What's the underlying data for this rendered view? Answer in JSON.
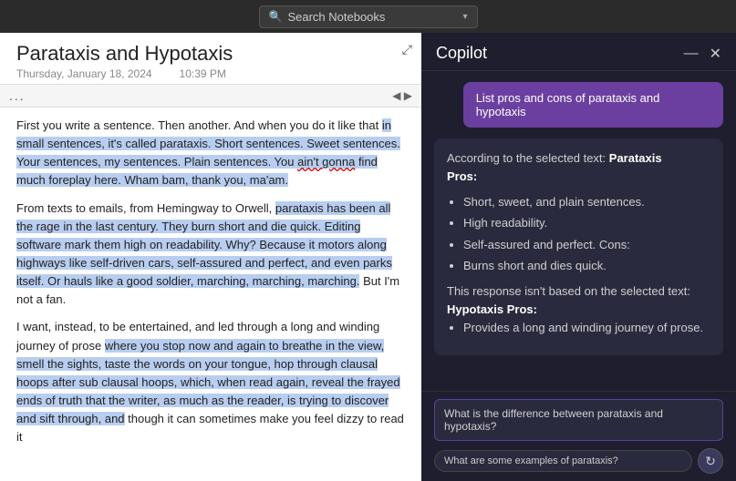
{
  "topbar": {
    "search_placeholder": "Search Notebooks",
    "search_icon": "🔍",
    "chevron_icon": "▾"
  },
  "note": {
    "title": "Parataxis and Hypotaxis",
    "date": "Thursday, January 18, 2024",
    "time": "10:39 PM",
    "expand_icon": "⤢",
    "toolbar_dots": "...",
    "scroll_arrow": "◀ ▶",
    "paragraphs": [
      {
        "id": "p1",
        "text": "First you write a sentence. Then another. And when you do it like that in small sentences, it's called parataxis. Short sentences. Sweet sentences. Your sentences, my sentences. Plain sentences. You ain't gonna find much foreplay here. Wham bam, thank you, ma'am."
      },
      {
        "id": "p2",
        "text": "From texts to emails, from Hemingway to Orwell, parataxis has been all the rage in the last century. They burn short and die quick. Editing software mark them high on readability. Why? Because it motors along highways like self-driven cars, self-assured and perfect, and even parks itself. Or hauls like a good soldier, marching, marching, marching. But I'm not a fan."
      },
      {
        "id": "p3",
        "text": "I want, instead, to be entertained, and led through a long and winding journey of prose where you stop now and again to breathe in the view, smell the sights, taste the words on your tongue, hop through clausal hoops after sub clausal hoops, which, when read again, reveal the frayed ends of truth that the writer, as much as the reader, is trying to discover and sift through, and though it can sometimes make you feel dizzy to read it"
      }
    ]
  },
  "copilot": {
    "title": "Copilot",
    "minimize_icon": "—",
    "close_icon": "✕",
    "prompt": "List pros and cons of parataxis\nand hypotaxis",
    "response": {
      "intro": "According to the selected text:",
      "parataxis_label": "Parataxis",
      "pros_label": "Pros:",
      "parataxis_pros": [
        "Short, sweet, and plain sentences.",
        "High readability.",
        "Self-assured and perfect. Cons:",
        "Burns short and dies quick."
      ],
      "transition_text": "This response isn't based on the selected text:",
      "hypotaxis_label": "Hypotaxis",
      "hypotaxis_pros_label": "Pros:",
      "hypotaxis_pros": [
        "Provides a long and winding journey of prose."
      ]
    },
    "input_value": "What is the difference between parataxis and hypotaxis?",
    "suggestion_label": "What are some examples of parataxis?",
    "refresh_icon": "↻"
  }
}
